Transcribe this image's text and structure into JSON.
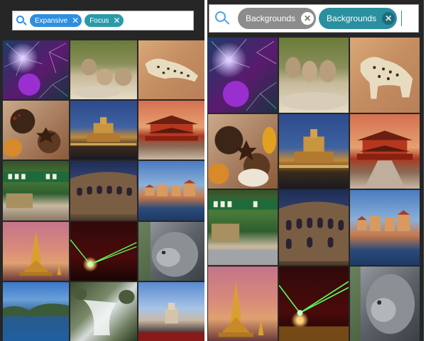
{
  "left_screen": {
    "search": {
      "icon": "search-icon",
      "chips": [
        {
          "label": "Expansive",
          "remove_icon": "close-icon",
          "color": "#2e8fe0"
        },
        {
          "label": "Focus",
          "remove_icon": "close-icon",
          "color": "#2a9aa8"
        }
      ]
    },
    "grid_images": [
      "fireworks",
      "cheetah cubs",
      "leopard",
      "spices",
      "castle at dusk",
      "chinese palace",
      "chinese street",
      "colosseum",
      "harbor town",
      "golden pagoda",
      "green laser",
      "stone lion",
      "lake and hills",
      "waterfall",
      "beach town"
    ]
  },
  "right_screen": {
    "search": {
      "icon": "search-icon",
      "chips": [
        {
          "label": "Backgrounds",
          "remove_icon": "close-icon",
          "color": "#8c8c8c"
        },
        {
          "label": "Backgrounds",
          "remove_icon": "close-icon",
          "color": "#2a8f9f"
        }
      ]
    },
    "grid_images": [
      "fireworks",
      "cheetah cubs",
      "leopard",
      "spices",
      "castle at dusk",
      "chinese palace",
      "chinese street",
      "colosseum",
      "harbor town",
      "golden pagoda",
      "green laser",
      "stone lion"
    ]
  }
}
